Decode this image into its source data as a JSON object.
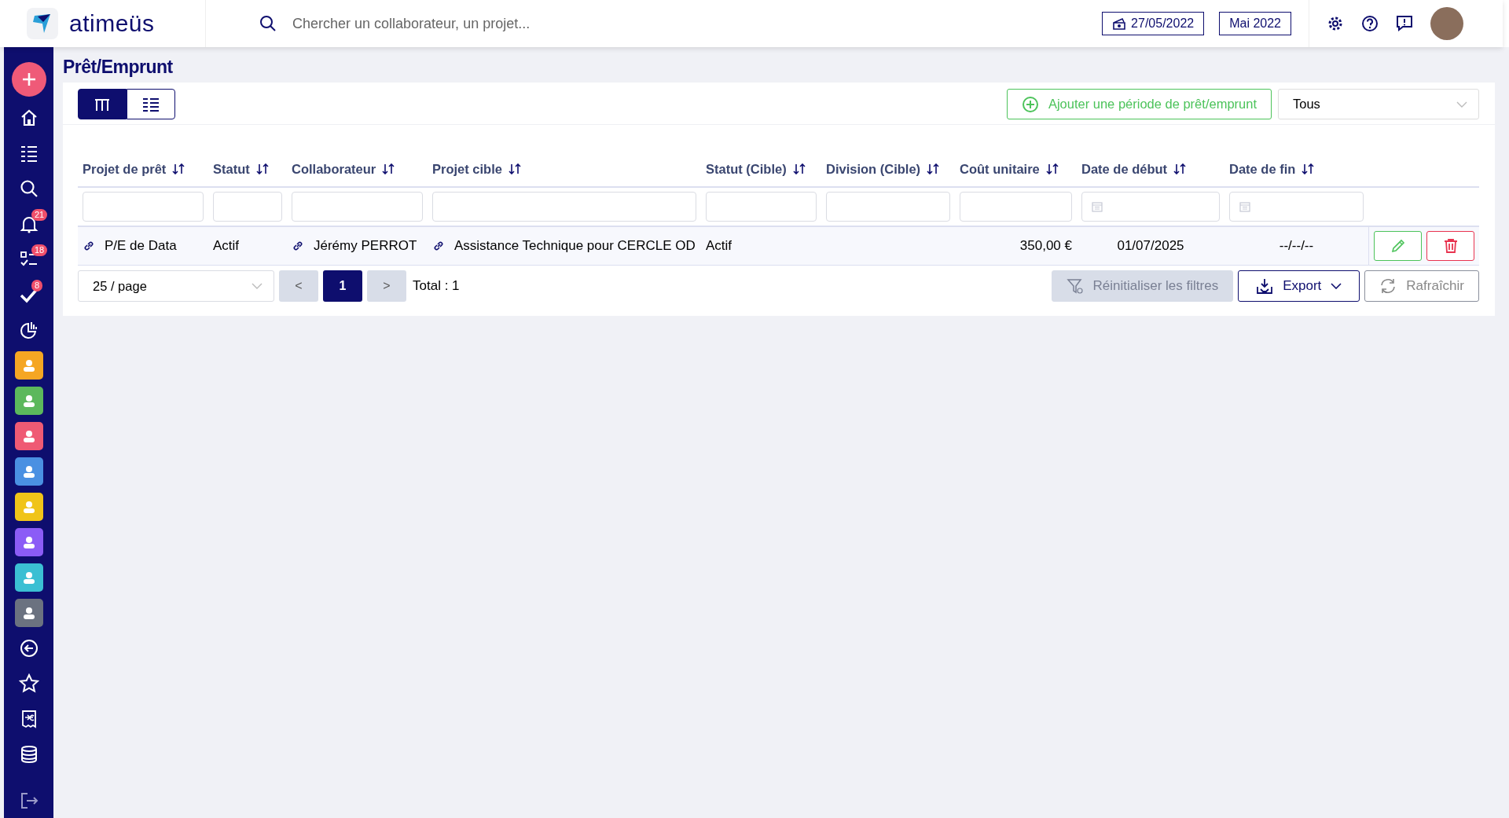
{
  "header": {
    "brand": "atimeüs",
    "search": {
      "placeholder": "Chercher un collaborateur, un projet..."
    },
    "date": "27/05/2022",
    "month": "Mai 2022"
  },
  "sidebar": {
    "items": [
      {
        "kind": "add"
      },
      {
        "kind": "icon"
      },
      {
        "kind": "icon"
      },
      {
        "kind": "icon"
      },
      {
        "kind": "icon",
        "badge": "21"
      },
      {
        "kind": "icon",
        "badge": "18"
      },
      {
        "kind": "icon",
        "badge": "8"
      },
      {
        "kind": "icon"
      },
      {
        "kind": "tile",
        "color": "#f5a623"
      },
      {
        "kind": "tile",
        "color": "#5cb85c"
      },
      {
        "kind": "tile",
        "color": "#ef5a74"
      },
      {
        "kind": "tile",
        "color": "#4a90e2"
      },
      {
        "kind": "tile",
        "color": "#f0c419"
      },
      {
        "kind": "tile",
        "color": "#8b5cf6"
      },
      {
        "kind": "tile",
        "color": "#3bbfd3"
      },
      {
        "kind": "tile",
        "color": "#6b7280"
      },
      {
        "kind": "icon"
      },
      {
        "kind": "icon"
      },
      {
        "kind": "icon"
      },
      {
        "kind": "icon"
      },
      {
        "kind": "icon"
      }
    ]
  },
  "page": {
    "title": "Prêt/Emprunt"
  },
  "toolbar": {
    "views": [
      {
        "selected": true
      },
      {
        "selected": false
      }
    ],
    "add_button": "Ajouter une période de prêt/emprunt",
    "filter_select": "Tous"
  },
  "table": {
    "columns": [
      "Projet de prêt",
      "Statut",
      "Collaborateur",
      "Projet cible",
      "Statut (Cible)",
      "Division (Cible)",
      "Coût unitaire",
      "Date de début",
      "Date de fin"
    ],
    "filters": [
      {
        "kind": "text"
      },
      {
        "kind": "text"
      },
      {
        "kind": "text"
      },
      {
        "kind": "text"
      },
      {
        "kind": "text"
      },
      {
        "kind": "text"
      },
      {
        "kind": "text"
      },
      {
        "kind": "date"
      },
      {
        "kind": "date"
      }
    ],
    "rows": [
      {
        "cells": [
          {
            "text": "P/E de Data",
            "link": true
          },
          {
            "text": "Actif",
            "link": false
          },
          {
            "text": "Jérémy PERROT",
            "link": true
          },
          {
            "text": "Assistance Technique pour CERCLE OD",
            "link": true
          },
          {
            "text": "Actif",
            "link": false
          },
          {},
          {
            "text": "350,00 €",
            "link": false
          },
          {
            "text": "01/07/2025",
            "link": false
          },
          {
            "text": "--/--/--",
            "link": false
          }
        ]
      }
    ]
  },
  "pagination": {
    "page_size": "25 / page",
    "prev": "<",
    "pages": [
      {
        "label": "1",
        "selected": true
      }
    ],
    "next": ">",
    "total": "Total : 1"
  },
  "actions": [
    {
      "kind": "reset",
      "label": "Réinitialiser les filtres",
      "disabled": true
    },
    {
      "kind": "export",
      "label": "Export",
      "disabled": false
    },
    {
      "kind": "refresh",
      "label": "Rafraîchir",
      "disabled": false
    }
  ]
}
